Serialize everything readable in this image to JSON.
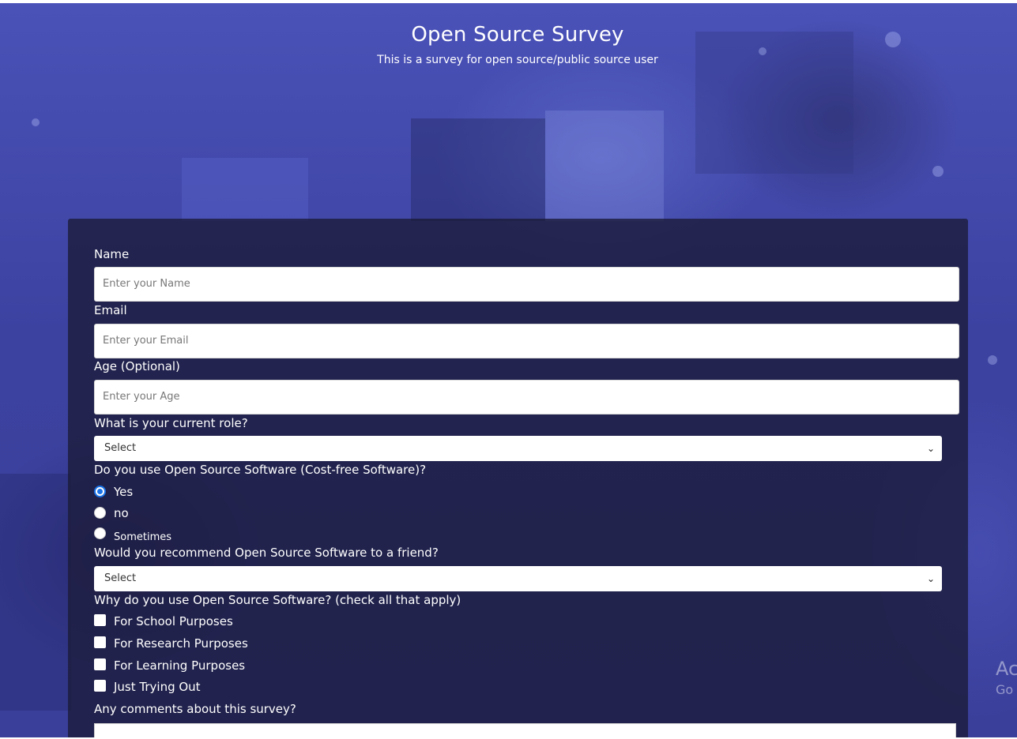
{
  "header": {
    "title": "Open Source Survey",
    "description": "This is a survey for open source/public source user"
  },
  "form": {
    "name": {
      "label": "Name",
      "placeholder": "Enter your Name"
    },
    "email": {
      "label": "Email",
      "placeholder": "Enter your Email"
    },
    "age": {
      "label": "Age (Optional)",
      "placeholder": "Enter your Age"
    },
    "role": {
      "label": "What is your current role?",
      "selected": "Select",
      "icon": "chevron-down-icon"
    },
    "use_oss": {
      "label": "Do you use Open Source Software (Cost-free Software)?",
      "options": [
        {
          "label": "Yes",
          "checked": true
        },
        {
          "label": "no",
          "checked": false
        },
        {
          "label": "Sometimes",
          "checked": false
        }
      ]
    },
    "recommend": {
      "label": "Would you recommend Open Source Software to a friend?",
      "selected": "Select",
      "icon": "chevron-down-icon"
    },
    "reasons": {
      "label": "Why do you use Open Source Software? (check all that apply)",
      "options": [
        {
          "label": "For School Purposes",
          "checked": false
        },
        {
          "label": "For Research Purposes",
          "checked": false
        },
        {
          "label": "For Learning Purposes",
          "checked": false
        },
        {
          "label": "Just Trying Out",
          "checked": false
        }
      ]
    },
    "comments": {
      "label": "Any comments about this survey?",
      "value": ""
    }
  },
  "watermark": {
    "line1": "Ac",
    "line2": "Go"
  },
  "colors": {
    "card_background": "#1b1b3a",
    "radio_accent": "#1a73e8",
    "text": "#ffffff"
  }
}
